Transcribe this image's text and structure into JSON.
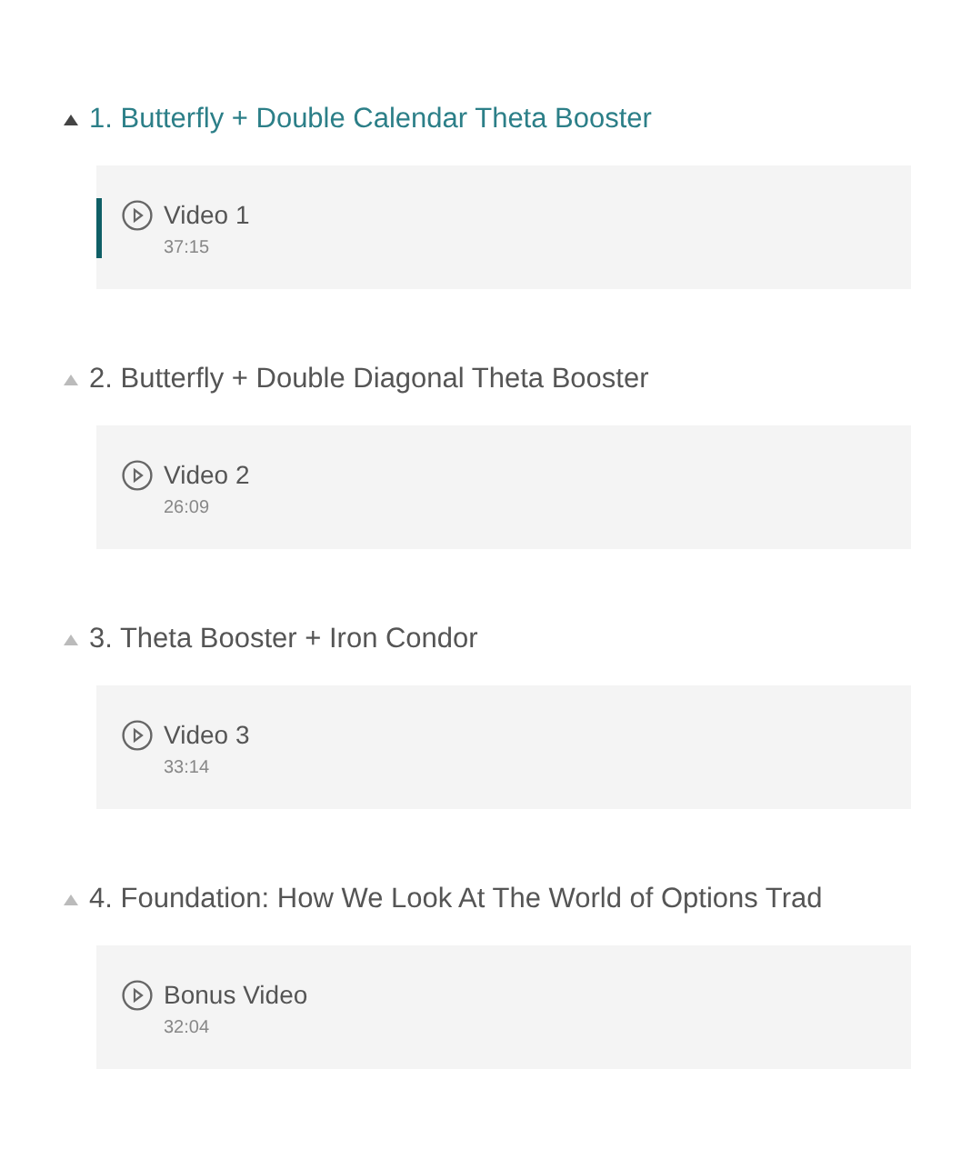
{
  "sections": [
    {
      "title": "1. Butterfly + Double Calendar Theta Booster",
      "selected": true,
      "lessons": [
        {
          "title": "Video 1",
          "duration": "37:15",
          "selected": true
        }
      ]
    },
    {
      "title": "2. Butterfly + Double Diagonal Theta Booster",
      "selected": false,
      "lessons": [
        {
          "title": "Video 2",
          "duration": "26:09",
          "selected": false
        }
      ]
    },
    {
      "title": "3. Theta Booster + Iron Condor",
      "selected": false,
      "lessons": [
        {
          "title": "Video 3",
          "duration": "33:14",
          "selected": false
        }
      ]
    },
    {
      "title": "4. Foundation: How We Look At The World of Options Trad",
      "selected": false,
      "lessons": [
        {
          "title": "Bonus Video",
          "duration": "32:04",
          "selected": false
        }
      ]
    }
  ]
}
